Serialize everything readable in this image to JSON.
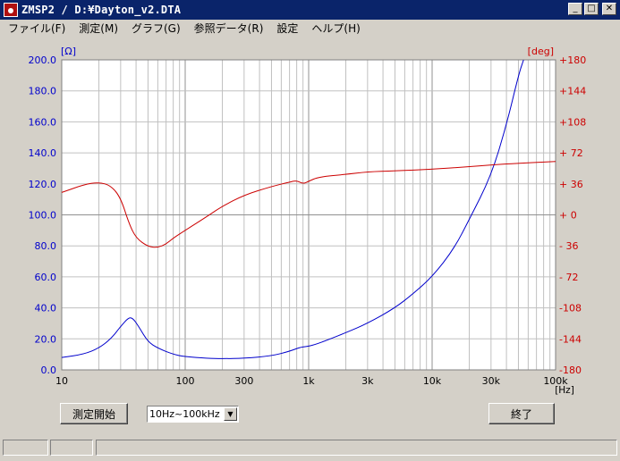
{
  "window": {
    "title": "ZMSP2 / D:¥Dayton_v2.DTA"
  },
  "title_buttons": {
    "minimize": "_",
    "maximize": "□",
    "close": "✕"
  },
  "menu": [
    {
      "label": "ファイル(F)"
    },
    {
      "label": "測定(M)"
    },
    {
      "label": "グラフ(G)"
    },
    {
      "label": "参照データ(R)"
    },
    {
      "label": "設定"
    },
    {
      "label": "ヘルプ(H)"
    }
  ],
  "controls": {
    "start_button": "測定開始",
    "range_select": "10Hz~100kHz",
    "exit_button": "終了"
  },
  "colors": {
    "impedance": "#0000cc",
    "phase": "#cc0000",
    "background": "#d4d0c8",
    "plot_bg": "#ffffff",
    "grid": "#c0c0c0"
  },
  "chart_data": {
    "type": "line",
    "xscale": "log",
    "xlim": [
      10,
      100000
    ],
    "xlabel": "[Hz]",
    "xticks": [
      "10",
      "100",
      "300",
      "1k",
      "3k",
      "10k",
      "30k",
      "100k"
    ],
    "y_left": {
      "label": "[Ω]",
      "lim": [
        0,
        200
      ],
      "ticks": [
        "200.0",
        "180.0",
        "160.0",
        "140.0",
        "120.0",
        "100.0",
        "80.0",
        "60.0",
        "40.0",
        "20.0",
        "0.0"
      ]
    },
    "y_right": {
      "label": "[deg]",
      "lim": [
        -180,
        180
      ],
      "ticks": [
        "+180",
        "+144",
        "+108",
        "+ 72",
        "+ 36",
        "+ 0",
        "- 36",
        "- 72",
        "-108",
        "-144",
        "-180"
      ]
    },
    "grid": true,
    "series": [
      {
        "axis": "left",
        "color": "#0000cc",
        "points": [
          [
            10,
            8
          ],
          [
            15,
            10
          ],
          [
            20,
            14
          ],
          [
            25,
            20
          ],
          [
            30,
            28
          ],
          [
            35,
            34
          ],
          [
            38,
            33
          ],
          [
            42,
            28
          ],
          [
            50,
            18
          ],
          [
            60,
            14
          ],
          [
            80,
            10
          ],
          [
            100,
            8.5
          ],
          [
            150,
            7.5
          ],
          [
            200,
            7.2
          ],
          [
            300,
            7.5
          ],
          [
            500,
            9
          ],
          [
            700,
            12
          ],
          [
            850,
            14.5
          ],
          [
            950,
            15
          ],
          [
            1100,
            16
          ],
          [
            1500,
            20
          ],
          [
            2000,
            24
          ],
          [
            3000,
            30
          ],
          [
            5000,
            40
          ],
          [
            7000,
            49
          ],
          [
            10000,
            60
          ],
          [
            15000,
            78
          ],
          [
            20000,
            97
          ],
          [
            30000,
            125
          ],
          [
            40000,
            158
          ],
          [
            50000,
            190
          ],
          [
            55000,
            200
          ]
        ]
      },
      {
        "axis": "right",
        "color": "#cc0000",
        "points": [
          [
            10,
            26
          ],
          [
            15,
            35
          ],
          [
            20,
            38
          ],
          [
            25,
            34
          ],
          [
            30,
            20
          ],
          [
            35,
            -10
          ],
          [
            40,
            -27
          ],
          [
            50,
            -37
          ],
          [
            60,
            -38
          ],
          [
            70,
            -34
          ],
          [
            80,
            -27
          ],
          [
            100,
            -18
          ],
          [
            150,
            -2
          ],
          [
            200,
            10
          ],
          [
            300,
            23
          ],
          [
            500,
            33
          ],
          [
            700,
            38
          ],
          [
            800,
            40
          ],
          [
            900,
            36
          ],
          [
            1000,
            39
          ],
          [
            1200,
            44
          ],
          [
            2000,
            47
          ],
          [
            3000,
            50
          ],
          [
            5000,
            51
          ],
          [
            10000,
            53
          ],
          [
            20000,
            56
          ],
          [
            30000,
            58
          ],
          [
            50000,
            60
          ],
          [
            100000,
            62
          ]
        ]
      }
    ]
  }
}
